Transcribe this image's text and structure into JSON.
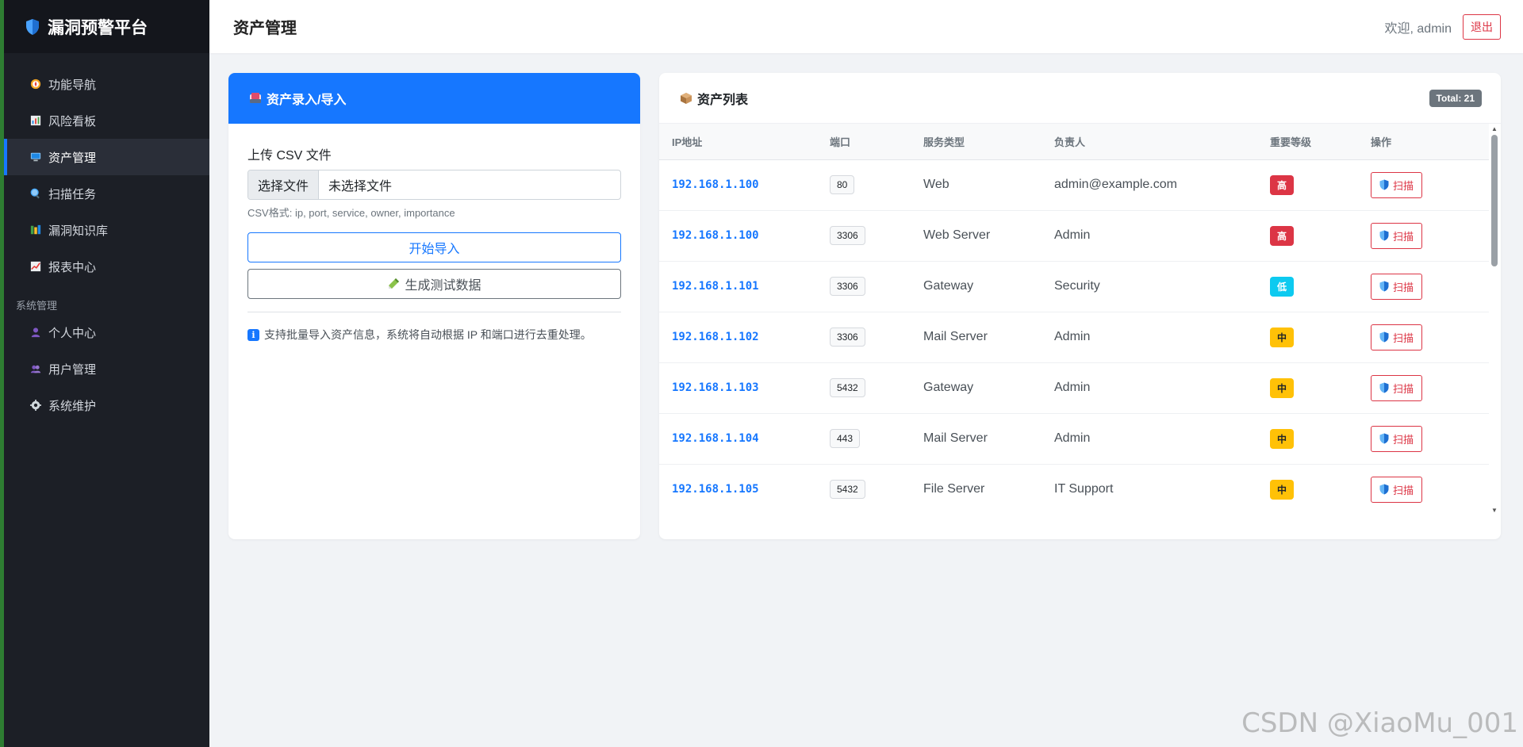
{
  "brand": {
    "title": "漏洞预警平台"
  },
  "sidebar": {
    "items": [
      {
        "label": "功能导航",
        "icon": "compass-icon"
      },
      {
        "label": "风险看板",
        "icon": "bar-chart-icon"
      },
      {
        "label": "资产管理",
        "icon": "monitor-icon",
        "active": true
      },
      {
        "label": "扫描任务",
        "icon": "magnifier-icon"
      },
      {
        "label": "漏洞知识库",
        "icon": "books-icon"
      },
      {
        "label": "报表中心",
        "icon": "line-chart-icon"
      }
    ],
    "section_label": "系统管理",
    "system_items": [
      {
        "label": "个人中心",
        "icon": "person-icon"
      },
      {
        "label": "用户管理",
        "icon": "users-icon"
      },
      {
        "label": "系统维护",
        "icon": "gear-icon"
      }
    ]
  },
  "header": {
    "title": "资产管理",
    "welcome": "欢迎, admin",
    "logout_label": "退出"
  },
  "import_card": {
    "title": "资产录入/导入",
    "upload_label": "上传 CSV 文件",
    "choose_file_label": "选择文件",
    "file_name": "未选择文件",
    "csv_help": "CSV格式: ip, port, service, owner, importance",
    "start_import_label": "开始导入",
    "generate_test_label": "生成测试数据",
    "info_text": "支持批量导入资产信息，系统将自动根据 IP 和端口进行去重处理。"
  },
  "list_card": {
    "title": "资产列表",
    "total_label": "Total: 21",
    "columns": [
      "IP地址",
      "端口",
      "服务类型",
      "负责人",
      "重要等级",
      "操作"
    ],
    "scan_label": "扫描",
    "rows": [
      {
        "ip": "192.168.1.100",
        "port": "80",
        "service": "Web",
        "owner": "admin@example.com",
        "level": "高"
      },
      {
        "ip": "192.168.1.100",
        "port": "3306",
        "service": "Web Server",
        "owner": "Admin",
        "level": "高"
      },
      {
        "ip": "192.168.1.101",
        "port": "3306",
        "service": "Gateway",
        "owner": "Security",
        "level": "低"
      },
      {
        "ip": "192.168.1.102",
        "port": "3306",
        "service": "Mail Server",
        "owner": "Admin",
        "level": "中"
      },
      {
        "ip": "192.168.1.103",
        "port": "5432",
        "service": "Gateway",
        "owner": "Admin",
        "level": "中"
      },
      {
        "ip": "192.168.1.104",
        "port": "443",
        "service": "Mail Server",
        "owner": "Admin",
        "level": "中"
      },
      {
        "ip": "192.168.1.105",
        "port": "5432",
        "service": "File Server",
        "owner": "IT Support",
        "level": "中"
      }
    ]
  },
  "level_colors": {
    "高": {
      "bg": "#dc3545",
      "fg": "#ffffff"
    },
    "中": {
      "bg": "#ffc107",
      "fg": "#212529"
    },
    "低": {
      "bg": "#0dcaf0",
      "fg": "#ffffff"
    }
  },
  "colors": {
    "primary": "#1677ff",
    "danger": "#dc3545",
    "sidebar_bg": "#1c1f26"
  },
  "watermark": "CSDN @XiaoMu_001"
}
